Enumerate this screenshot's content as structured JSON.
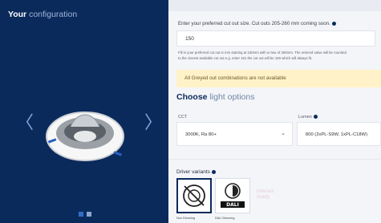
{
  "left": {
    "title_strong": "Your",
    "title_rest": "configuration",
    "prev_arrow": "〈",
    "next_arrow": "〉",
    "product_icon": "downlight-product-image"
  },
  "cutout": {
    "instruction": "Enter your preferred cut out size. Cut outs 205-260 mm coming soon.",
    "value": "150",
    "help_line1": "Fill in your preferred cut out in mm starting at 150mm with a max of 260mm. The entered value will be rounded",
    "help_line2": "to the closest available cut out e.g. enter 161 the cut out will be 160 which will always fit."
  },
  "notice": "All Greyed out combinations are not available",
  "choose": {
    "strong": "Choose",
    "rest": "light options"
  },
  "cct": {
    "label": "CCT",
    "value": "3000K, Ra 80+"
  },
  "lumen": {
    "label": "Lumen",
    "value": "800 (2xPL-S9W, 1xPL-C18W)"
  },
  "driver": {
    "label": "Driver variants",
    "cards": [
      {
        "label": "Non Dimming",
        "icon": "non-dimming-icon"
      },
      {
        "label": "DALI Dimming",
        "icon": "dali-dimming-icon",
        "badge": "DALI"
      }
    ],
    "ghost_line1": "Interact",
    "ghost_line2": "ready"
  },
  "colors": {
    "brand_navy": "#0b2a5c",
    "notice_bg": "#fff2c8",
    "dot_active": "#2e6fc6"
  }
}
